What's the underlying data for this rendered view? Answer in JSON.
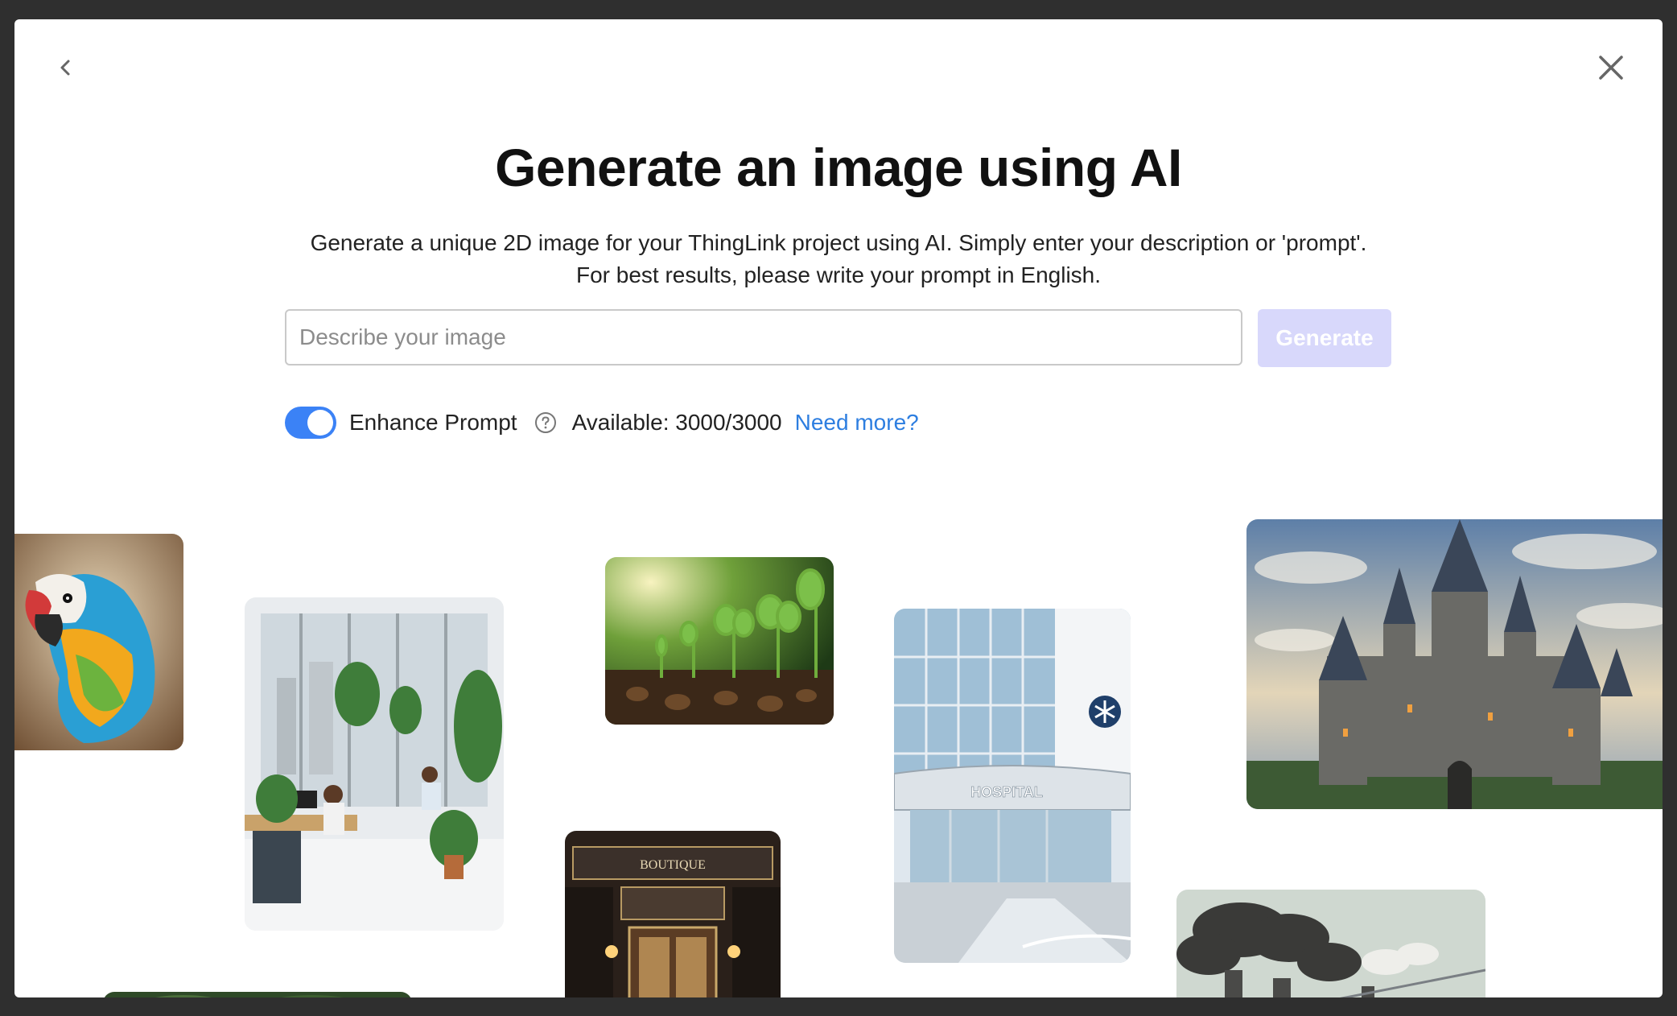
{
  "modal": {
    "title": "Generate an image using AI",
    "subtitle_line1": "Generate a unique 2D image for your ThingLink project using AI. Simply enter your description or 'prompt'.",
    "subtitle_line2": "For best results, please write your prompt in English."
  },
  "prompt": {
    "placeholder": "Describe your image",
    "value": ""
  },
  "generate_button": {
    "label": "Generate",
    "enabled": false
  },
  "options": {
    "enhance_label": "Enhance Prompt",
    "enhance_on": true,
    "available_text": "Available: 3000/3000",
    "need_more_label": "Need more?"
  },
  "examples": {
    "hospital_sign": "HOSPITAL",
    "boutique_sign": "BOUTIQUE"
  },
  "colors": {
    "accent": "#3b82f6",
    "link": "#2d7ee0",
    "generate_disabled": "#d8d8fb"
  },
  "icons": {
    "back": "chevron-left-icon",
    "close": "close-icon",
    "help": "question-circle-icon"
  }
}
